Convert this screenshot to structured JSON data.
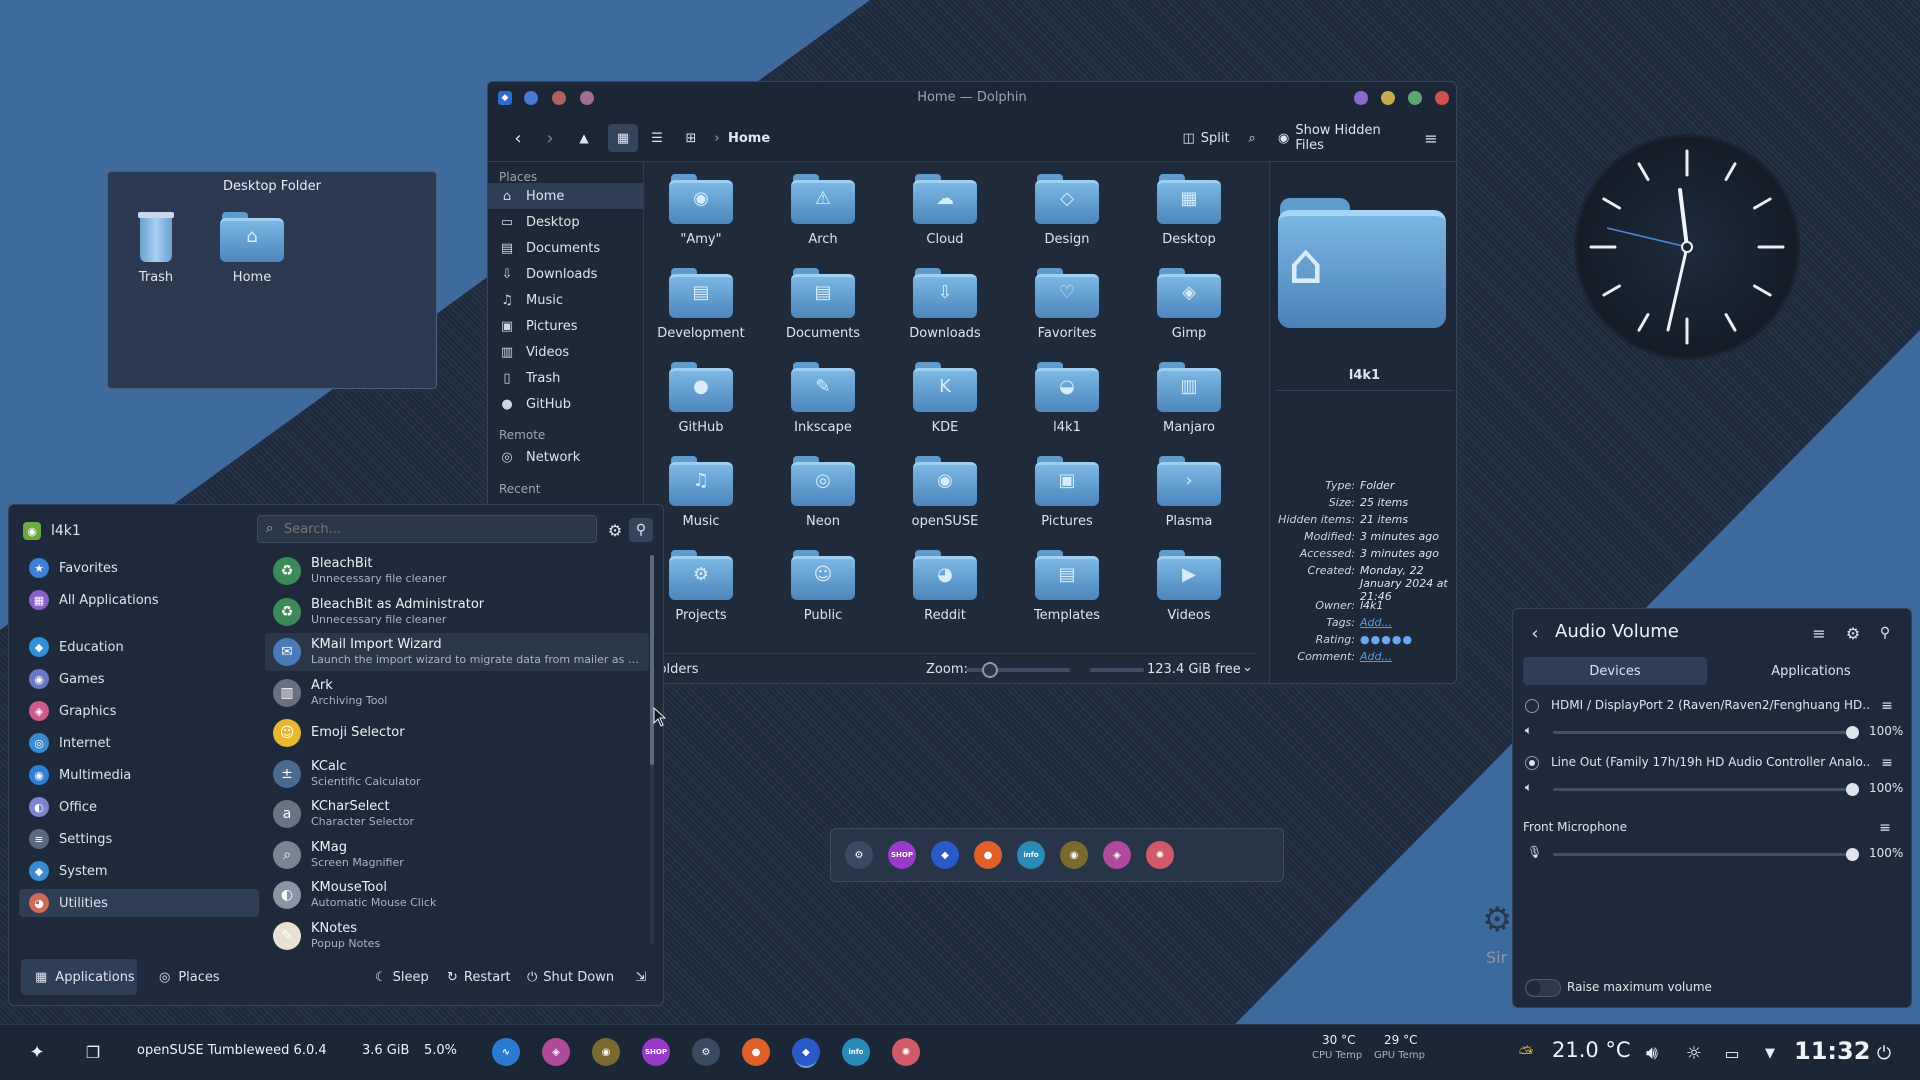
{
  "desktop_folder": {
    "title": "Desktop Folder",
    "items": [
      {
        "label": "Trash",
        "icon": "trash-icon"
      },
      {
        "label": "Home",
        "icon": "home-folder-icon"
      }
    ]
  },
  "dolphin": {
    "title": "Home — Dolphin",
    "breadcrumb": "Home",
    "split_label": "Split",
    "hidden_label": "Show Hidden Files",
    "places_header": "Places",
    "places": [
      "Home",
      "Desktop",
      "Documents",
      "Downloads",
      "Music",
      "Pictures",
      "Videos",
      "Trash",
      "GitHub"
    ],
    "remote_header": "Remote",
    "remote": [
      "Network"
    ],
    "recent_header": "Recent",
    "folders": [
      "\"Amy\"",
      "Arch",
      "Cloud",
      "Design",
      "Desktop",
      "Development",
      "Documents",
      "Downloads",
      "Favorites",
      "Gimp",
      "GitHub",
      "Inkscape",
      "KDE",
      "l4k1",
      "Manjaro",
      "Music",
      "Neon",
      "openSUSE",
      "Pictures",
      "Plasma",
      "Projects",
      "Public",
      "Reddit",
      "Templates",
      "Videos"
    ],
    "status": {
      "left": "folders",
      "zoom_label": "Zoom:",
      "free": "123.4 GiB free"
    },
    "info": {
      "name": "l4k1",
      "rows": [
        {
          "k": "Type:",
          "v": "Folder"
        },
        {
          "k": "Size:",
          "v": "25 items"
        },
        {
          "k": "Hidden items:",
          "v": "21 items"
        },
        {
          "k": "Modified:",
          "v": "3 minutes ago"
        },
        {
          "k": "Accessed:",
          "v": "3 minutes ago"
        },
        {
          "k": "Created:",
          "v": "Monday, 22 January 2024 at 21:46"
        },
        {
          "k": "Owner:",
          "v": "l4k1"
        },
        {
          "k": "Tags:",
          "v": "Add..."
        },
        {
          "k": "Rating:",
          "v": ""
        },
        {
          "k": "Comment:",
          "v": "Add..."
        }
      ]
    }
  },
  "launcher": {
    "user": "l4k1",
    "search_placeholder": "Search...",
    "categories": [
      {
        "label": "Favorites",
        "color": "#3f7fd8"
      },
      {
        "label": "All Applications",
        "color": "#8a5fc8"
      },
      {
        "label": "Education",
        "color": "#2f8fd8"
      },
      {
        "label": "Games",
        "color": "#6a78c8"
      },
      {
        "label": "Graphics",
        "color": "#d05a8a"
      },
      {
        "label": "Internet",
        "color": "#3a8ad0"
      },
      {
        "label": "Multimedia",
        "color": "#2f7fd8"
      },
      {
        "label": "Office",
        "color": "#7a86d0"
      },
      {
        "label": "Settings",
        "color": "#5a6b80"
      },
      {
        "label": "System",
        "color": "#3a8ad0"
      },
      {
        "label": "Utilities",
        "color": "#d06a5a"
      }
    ],
    "apps": [
      {
        "name": "BleachBit",
        "desc": "Unnecessary file cleaner",
        "color": "#3c8a5a",
        "glyph": "♻"
      },
      {
        "name": "BleachBit as Administrator",
        "desc": "Unnecessary file cleaner",
        "color": "#3c8a5a",
        "glyph": "♻"
      },
      {
        "name": "KMail Import Wizard",
        "desc": "Launch the import wizard to migrate data from mailer as thunde...",
        "color": "#4a7ab8",
        "glyph": "✉"
      },
      {
        "name": "Ark",
        "desc": "Archiving Tool",
        "color": "#6a7080",
        "glyph": "▥"
      },
      {
        "name": "Emoji Selector",
        "desc": "",
        "color": "#e8b830",
        "glyph": "☺"
      },
      {
        "name": "KCalc",
        "desc": "Scientific Calculator",
        "color": "#4a6a90",
        "glyph": "±"
      },
      {
        "name": "KCharSelect",
        "desc": "Character Selector",
        "color": "#6a7484",
        "glyph": "a"
      },
      {
        "name": "KMag",
        "desc": "Screen Magnifier",
        "color": "#7a8494",
        "glyph": "⌕"
      },
      {
        "name": "KMouseTool",
        "desc": "Automatic Mouse Click",
        "color": "#8a94a4",
        "glyph": "◐"
      },
      {
        "name": "KNotes",
        "desc": "Popup Notes",
        "color": "#e8e0d0",
        "glyph": "✎"
      }
    ],
    "footer": {
      "applications": "Applications",
      "places": "Places",
      "sleep": "Sleep",
      "restart": "Restart",
      "shutdown": "Shut Down"
    }
  },
  "dock": {
    "apps": [
      {
        "name": "settings",
        "color": "#3a4a60",
        "glyph": "⚙"
      },
      {
        "name": "shop",
        "color": "#9a3ac8",
        "glyph": "SHOP"
      },
      {
        "name": "dolphin",
        "color": "#2a5ac8",
        "glyph": "◆"
      },
      {
        "name": "firefox",
        "color": "#e0602a",
        "glyph": "●"
      },
      {
        "name": "info",
        "color": "#2a8ab8",
        "glyph": "info"
      },
      {
        "name": "gimp",
        "color": "#7a6a30",
        "glyph": "◉"
      },
      {
        "name": "krita",
        "color": "#b04a9a",
        "glyph": "◈"
      },
      {
        "name": "pinwheel",
        "color": "#d05a6a",
        "glyph": "✺"
      }
    ]
  },
  "audio": {
    "title": "Audio Volume",
    "tabs": [
      "Devices",
      "Applications"
    ],
    "devices": [
      {
        "name": "HDMI / DisplayPort 2 (Raven/Raven2/Fenghuang HD...",
        "value": "100%"
      },
      {
        "name": "Line Out (Family 17h/19h HD Audio Controller Analo...",
        "value": "100%"
      }
    ],
    "mic": {
      "name": "Front Microphone",
      "value": "100%"
    },
    "raise_label": "Raise maximum volume",
    "behind_text": "Sir"
  },
  "panel": {
    "os": "openSUSE Tumbleweed 6.0.4",
    "mem": "3.6 GiB",
    "cpu": "5.0%",
    "cpu_temp": "30 °C",
    "cpu_temp_label": "CPU Temp",
    "gpu_temp": "29 °C",
    "gpu_temp_label": "GPU Temp",
    "weather": "21.0 °C",
    "time": "11:32"
  }
}
